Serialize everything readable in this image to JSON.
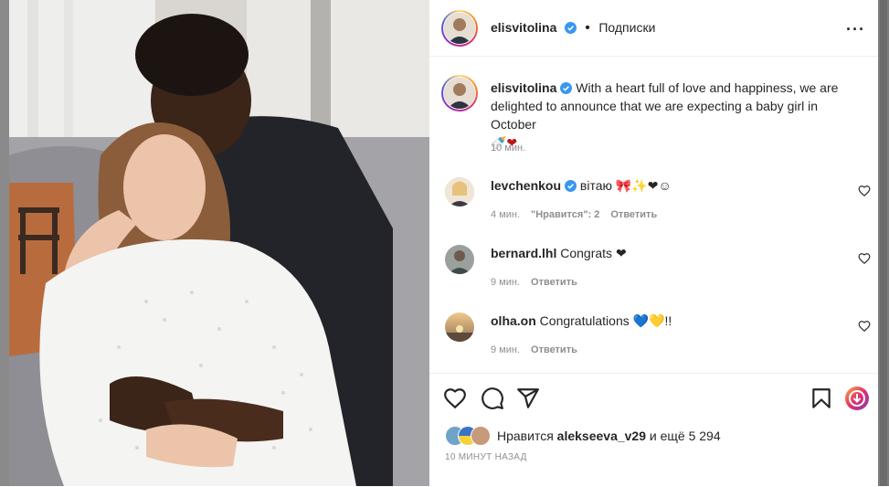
{
  "post": {
    "username": "elisvitolina",
    "follow_label": "Подписки",
    "more_label": "···",
    "caption_user": "elisvitolina",
    "caption_text": "With a heart full of love and happiness, we are delighted to announce that we are expecting a baby girl in October",
    "caption_emoji": "🍼❤",
    "caption_time": "10 мин."
  },
  "comments": [
    {
      "user": "levchenkou",
      "text": "вітаю 🎀✨❤☺",
      "time": "4 мин.",
      "likes": "\"Нравится\": 2",
      "reply": "Ответить"
    },
    {
      "user": "bernard.lhl",
      "text": "Congrats ❤",
      "time": "9 мин.",
      "reply": "Ответить"
    },
    {
      "user": "olha.on",
      "text": "Congratulations 💙💛!!",
      "time": "9 мин.",
      "reply": "Ответить"
    }
  ],
  "likes": {
    "prefix": "Нравится",
    "user": "alekseeva_v29",
    "suffix": "и ещё 5 294"
  },
  "timestamp": "10 МИНУТ НАЗАД",
  "icons": [
    "heart-icon",
    "comment-icon",
    "share-icon",
    "bookmark-icon",
    "verified-badge-icon",
    "more-options-icon"
  ],
  "colors": {
    "verified": "#3897f0",
    "heart": "#b91a1f",
    "meta": "#8e8e8e",
    "text": "#262626"
  }
}
